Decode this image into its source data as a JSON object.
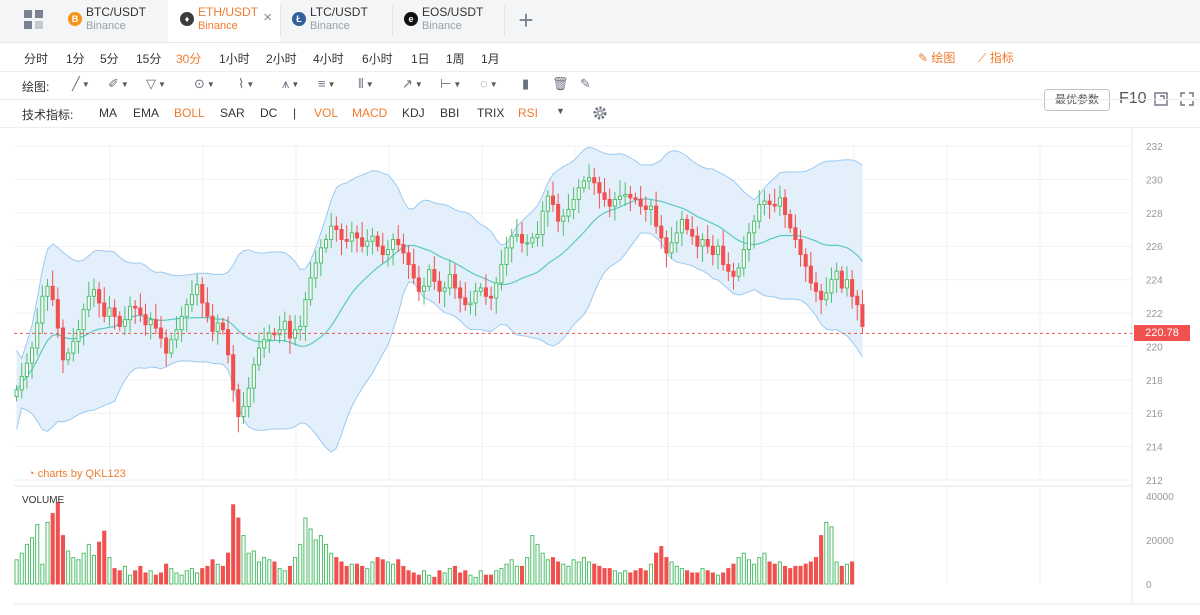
{
  "tabs": [
    {
      "pair": "BTC/USDT",
      "exchange": "Binance",
      "coin": "B",
      "color": "#f7931a",
      "active": false
    },
    {
      "pair": "ETH/USDT",
      "exchange": "Binance",
      "coin": "♦",
      "color": "#3c3c3d",
      "active": true
    },
    {
      "pair": "LTC/USDT",
      "exchange": "Binance",
      "coin": "Ł",
      "color": "#345d9d",
      "active": false
    },
    {
      "pair": "EOS/USDT",
      "exchange": "Binance",
      "coin": "e",
      "color": "#111111",
      "active": false
    }
  ],
  "tab_close": "×",
  "add_tab": "+",
  "periods": [
    "分时",
    "1分",
    "5分",
    "15分",
    "30分",
    "1小时",
    "2小时",
    "4小时",
    "6小时",
    "1日",
    "1周",
    "1月"
  ],
  "active_period": "30分",
  "toolbar_right": {
    "draw": "绘图",
    "indicator": "指标",
    "best_params": "最优参数",
    "f10": "F10"
  },
  "draw": {
    "label": "绘图:",
    "tools": [
      "line-tool-icon",
      "pen-tool-icon",
      "triangle-tool-icon",
      "circle-tool-icon",
      "zigzag-tool-icon",
      "pattern-tool-icon",
      "fib-lines-icon",
      "gann-icon",
      "arrow-tool-icon",
      "range-tool-icon",
      "comment-icon",
      "bar-marker-icon",
      "trash-icon",
      "brush-icon"
    ]
  },
  "indicators": {
    "label": "技术指标:",
    "items": [
      {
        "name": "MA",
        "on": false
      },
      {
        "name": "EMA",
        "on": false
      },
      {
        "name": "BOLL",
        "on": true
      },
      {
        "name": "SAR",
        "on": false
      },
      {
        "name": "DC",
        "on": false
      },
      {
        "name": "|",
        "on": false
      },
      {
        "name": "VOL",
        "on": true
      },
      {
        "name": "MACD",
        "on": true
      },
      {
        "name": "KDJ",
        "on": false
      },
      {
        "name": "BBI",
        "on": false
      },
      {
        "name": "TRIX",
        "on": false
      },
      {
        "name": "RSI",
        "on": true
      }
    ]
  },
  "chart": {
    "watermark": "charts by QKL123",
    "volume_label": "VOLUME",
    "current_price": "220.78",
    "price_ticks": [
      "232",
      "230",
      "228",
      "226",
      "224",
      "222",
      "220",
      "218",
      "216",
      "214",
      "212"
    ],
    "volume_ticks": [
      "40000",
      "20000",
      "0"
    ],
    "up_color": "#4fbf6b",
    "down_color": "#f0514f",
    "band_color": "#9cc9f0"
  },
  "chart_data": {
    "type": "candlestick",
    "price_range": [
      212,
      232
    ],
    "volume_range": [
      0,
      40000
    ],
    "grid": true,
    "closes": [
      217.4,
      218.2,
      219.0,
      219.9,
      221.4,
      223.0,
      223.6,
      222.8,
      221.1,
      219.2,
      219.6,
      220.3,
      221.0,
      222.2,
      223.0,
      223.4,
      222.6,
      221.8,
      222.3,
      221.8,
      221.2,
      221.6,
      222.4,
      222.3,
      221.9,
      221.3,
      221.6,
      221.1,
      220.5,
      219.6,
      220.4,
      221.0,
      221.8,
      222.5,
      223.1,
      223.7,
      222.6,
      221.8,
      220.9,
      221.4,
      221.0,
      219.5,
      217.4,
      215.8,
      216.4,
      217.5,
      218.9,
      219.9,
      220.4,
      220.8,
      220.7,
      221.0,
      221.5,
      220.5,
      221.0,
      221.2,
      222.8,
      224.1,
      225.0,
      225.9,
      226.4,
      227.2,
      227.0,
      226.4,
      226.3,
      226.8,
      226.5,
      226.0,
      226.3,
      226.6,
      226.0,
      225.5,
      225.8,
      226.4,
      226.1,
      225.6,
      224.9,
      224.1,
      223.3,
      223.6,
      224.6,
      223.9,
      223.3,
      223.5,
      224.3,
      223.5,
      222.9,
      222.5,
      222.6,
      223.3,
      223.5,
      223.0,
      222.9,
      223.8,
      224.9,
      225.9,
      226.6,
      226.7,
      226.2,
      226.2,
      226.5,
      226.7,
      228.1,
      229.0,
      228.5,
      227.5,
      227.8,
      228.2,
      228.8,
      229.5,
      229.9,
      230.1,
      229.8,
      229.2,
      228.8,
      228.4,
      228.8,
      229.0,
      229.1,
      228.9,
      228.8,
      228.4,
      228.2,
      228.4,
      227.2,
      226.5,
      225.6,
      226.2,
      226.8,
      227.6,
      227.0,
      226.6,
      226.0,
      226.4,
      226.0,
      225.5,
      226.0,
      224.9,
      224.5,
      224.2,
      224.7,
      225.8,
      226.8,
      227.5,
      228.5,
      228.7,
      228.5,
      228.4,
      228.9,
      227.9,
      227.1,
      226.4,
      225.5,
      224.8,
      223.8,
      223.3,
      222.8,
      223.2,
      224.0,
      224.5,
      223.5,
      224.0,
      223.0,
      222.5,
      221.2
    ],
    "volumes": [
      11000,
      14000,
      18000,
      21000,
      27000,
      9000,
      28000,
      32000,
      37000,
      22000,
      15000,
      12000,
      11000,
      14000,
      18000,
      13000,
      19000,
      24000,
      12000,
      7000,
      6000,
      8000,
      4000,
      6000,
      8000,
      5000,
      6000,
      4000,
      5000,
      9000,
      7000,
      5000,
      4000,
      6000,
      7000,
      5000,
      7000,
      8000,
      11000,
      9000,
      8000,
      14000,
      36000,
      30000,
      22000,
      14000,
      15000,
      10000,
      12000,
      11000,
      10000,
      7000,
      6000,
      8000,
      12000,
      18000,
      30000,
      25000,
      20000,
      22000,
      18000,
      14000,
      12000,
      10000,
      8000,
      9000,
      9000,
      8000,
      7000,
      10000,
      12000,
      11000,
      10000,
      9000,
      11000,
      8000,
      6000,
      5000,
      4000,
      6000,
      4000,
      3000,
      6000,
      5000,
      7000,
      8000,
      5000,
      6000,
      4000,
      3000,
      6000,
      4000,
      4000,
      6000,
      7000,
      9000,
      11000,
      8000,
      8000,
      12000,
      22000,
      18000,
      14000,
      11000,
      12000,
      10000,
      9000,
      8000,
      11000,
      10000,
      12000,
      10000,
      9000,
      8000,
      7000,
      7000,
      6000,
      5000,
      6000,
      5000,
      6000,
      7000,
      6000,
      9000,
      14000,
      17000,
      12000,
      10000,
      8000,
      7000,
      6000,
      5000,
      5000,
      7000,
      6000,
      5000,
      4000,
      5000,
      7000,
      9000,
      12000,
      14000,
      11000,
      9000,
      12000,
      14000,
      10000,
      9000,
      10000,
      8000,
      7000,
      8000,
      8000,
      9000,
      10000,
      12000,
      22000,
      28000,
      26000,
      10000,
      8000,
      9000,
      10000
    ]
  }
}
